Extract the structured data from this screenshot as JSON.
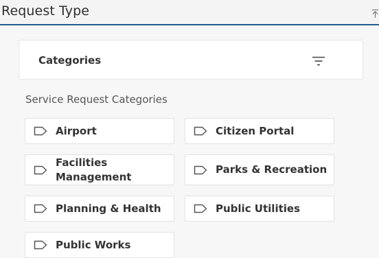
{
  "header": {
    "title": "Request Type"
  },
  "categories_header": {
    "label": "Categories"
  },
  "section": {
    "label": "Service Request Categories"
  },
  "tiles": [
    {
      "label": "Airport"
    },
    {
      "label": "Citizen Portal"
    },
    {
      "label": "Facilities Management"
    },
    {
      "label": "Parks & Recreation"
    },
    {
      "label": "Planning & Health"
    },
    {
      "label": "Public Utilities"
    },
    {
      "label": "Public Works"
    }
  ],
  "icons": {
    "collapse": "collapse-up-icon",
    "filter": "filter-icon",
    "tag": "tag-icon"
  },
  "colors": {
    "header_border": "#1f5c8a",
    "panel_background": "#f7f7f7",
    "tile_background": "#ffffff"
  }
}
